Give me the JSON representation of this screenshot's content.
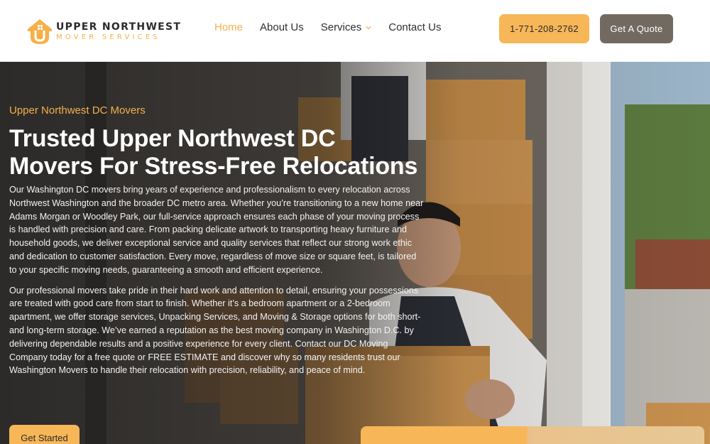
{
  "brand": {
    "name_line1": "UPPER NORTHWEST",
    "name_line2": "MOVER SERVICES",
    "accent": "#f5b04a",
    "dark_button": "#726a60"
  },
  "nav": {
    "items": [
      {
        "label": "Home",
        "active": true
      },
      {
        "label": "About Us"
      },
      {
        "label": "Services",
        "has_dropdown": true
      },
      {
        "label": "Contact Us"
      }
    ]
  },
  "header_buttons": {
    "phone": "1-771-208-2762",
    "quote": "Get A Quote"
  },
  "hero": {
    "eyebrow": "Upper Northwest DC Movers",
    "title_line1": "Trusted Upper Northwest DC",
    "title_line2": "Movers For Stress-Free Relocations",
    "paragraph1": "Our Washington DC movers bring years of experience and professionalism to every relocation across Northwest Washington and the broader DC metro area. Whether you’re transitioning to a new home near Adams Morgan or Woodley Park, our full-service approach ensures each phase of your moving process is handled with precision and care. From packing delicate artwork to transporting heavy furniture and household goods, we deliver exceptional service and quality services that reflect our strong work ethic and dedication to customer satisfaction. Every move, regardless of move size or square feet, is tailored to your specific moving needs, guaranteeing a smooth and efficient experience.",
    "paragraph2": "Our professional movers take pride in their hard work and attention to detail, ensuring your possessions are treated with good care from start to finish. Whether it’s a bedroom apartment or a 2-bedroom apartment, we offer storage services, Unpacking Services, and Moving & Storage options for both short-and long-term storage. We’ve earned a reputation as the best moving company in Washington D.C. by delivering dependable results and a positive experience for every client. Contact our DC Moving Company today for a free quote or FREE ESTIMATE and discover why so many residents trust our Washington Movers to handle their relocation with precision, reliability, and peace of mind.",
    "cta": "Get Started"
  }
}
